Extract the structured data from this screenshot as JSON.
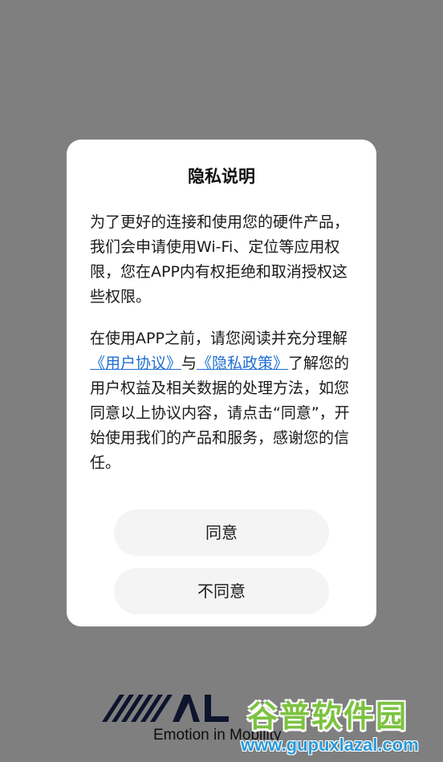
{
  "brand": {
    "tagline": "Emotion in Mobility",
    "logo_icon": "alpine-logo-icon",
    "color": "#1b2a5a"
  },
  "dialog": {
    "title": "隐私说明",
    "paragraph1": "为了更好的连接和使用您的硬件产品，我们会申请使用Wi-Fi、定位等应用权限，您在APP内有权拒绝和取消授权这些权限。",
    "paragraph2": {
      "part1": "在使用APP之前，请您阅读并充分理解",
      "link1": "《用户协议》",
      "part2": "与",
      "link2": "《隐私政策》",
      "part3": "了解您的用户权益及相关数据的处理方法，如您同意以上协议内容，请点击“同意”，开始使用我们的产品和服务，感谢您的信任。"
    },
    "agree_label": "同意",
    "disagree_label": "不同意"
  },
  "watermark": {
    "title": "谷普软件园",
    "url": "www.gupuxlazal.com"
  },
  "colors": {
    "link": "#1f6fd1",
    "button_bg": "#f4f4f4",
    "scrim": "rgba(0,0,0,0.5)"
  }
}
